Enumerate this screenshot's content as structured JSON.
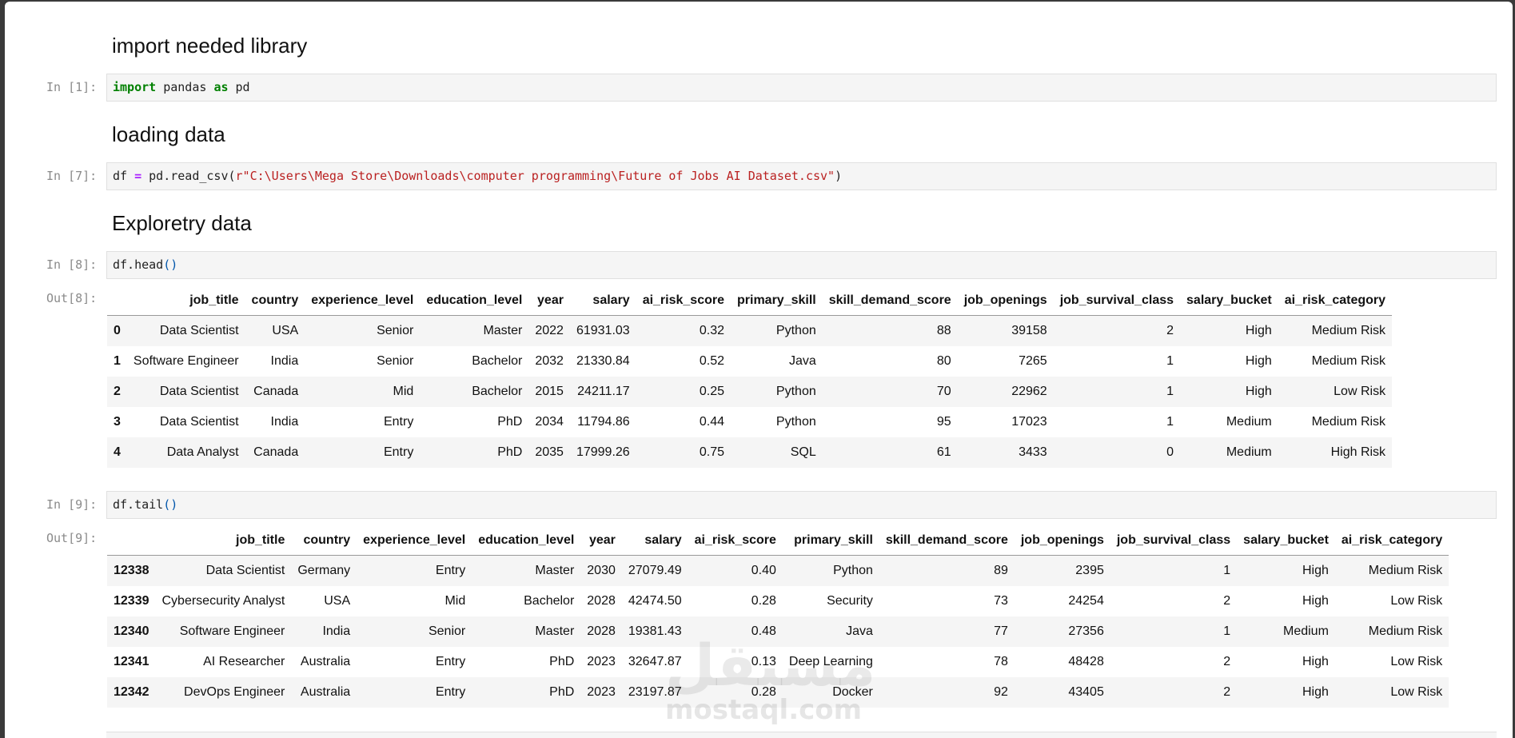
{
  "cells": {
    "md1": "import needed library",
    "in1": {
      "prompt": "In [1]:",
      "kw1": "import",
      "mid": " pandas ",
      "kw2": "as",
      "end": " pd"
    },
    "md2": "loading data",
    "in7": {
      "prompt": "In [7]:",
      "a": "df ",
      "op": "=",
      "b": " pd.read_csv(",
      "str": "r\"C:\\Users\\Mega Store\\Downloads\\computer programming\\Future of Jobs AI Dataset.csv\"",
      "c": ")"
    },
    "md3": "Exploretry data",
    "in8": {
      "prompt": "In [8]:",
      "code": "df.head",
      "paren": "()"
    },
    "out8": "Out[8]:",
    "in9": {
      "prompt": "In [9]:",
      "code": "df.tail",
      "paren": "()"
    },
    "out9": "Out[9]:"
  },
  "columns": [
    "job_title",
    "country",
    "experience_level",
    "education_level",
    "year",
    "salary",
    "ai_risk_score",
    "primary_skill",
    "skill_demand_score",
    "job_openings",
    "job_survival_class",
    "salary_bucket",
    "ai_risk_category"
  ],
  "head_rows": [
    [
      "0",
      "Data Scientist",
      "USA",
      "Senior",
      "Master",
      "2022",
      "61931.03",
      "0.32",
      "Python",
      "88",
      "39158",
      "2",
      "High",
      "Medium Risk"
    ],
    [
      "1",
      "Software Engineer",
      "India",
      "Senior",
      "Bachelor",
      "2032",
      "21330.84",
      "0.52",
      "Java",
      "80",
      "7265",
      "1",
      "High",
      "Medium Risk"
    ],
    [
      "2",
      "Data Scientist",
      "Canada",
      "Mid",
      "Bachelor",
      "2015",
      "24211.17",
      "0.25",
      "Python",
      "70",
      "22962",
      "1",
      "High",
      "Low Risk"
    ],
    [
      "3",
      "Data Scientist",
      "India",
      "Entry",
      "PhD",
      "2034",
      "11794.86",
      "0.44",
      "Python",
      "95",
      "17023",
      "1",
      "Medium",
      "Medium Risk"
    ],
    [
      "4",
      "Data Analyst",
      "Canada",
      "Entry",
      "PhD",
      "2035",
      "17999.26",
      "0.75",
      "SQL",
      "61",
      "3433",
      "0",
      "Medium",
      "High Risk"
    ]
  ],
  "tail_rows": [
    [
      "12338",
      "Data Scientist",
      "Germany",
      "Entry",
      "Master",
      "2030",
      "27079.49",
      "0.40",
      "Python",
      "89",
      "2395",
      "1",
      "High",
      "Medium Risk"
    ],
    [
      "12339",
      "Cybersecurity Analyst",
      "USA",
      "Mid",
      "Bachelor",
      "2028",
      "42474.50",
      "0.28",
      "Security",
      "73",
      "24254",
      "2",
      "High",
      "Low Risk"
    ],
    [
      "12340",
      "Software Engineer",
      "India",
      "Senior",
      "Master",
      "2028",
      "19381.43",
      "0.48",
      "Java",
      "77",
      "27356",
      "1",
      "Medium",
      "Medium Risk"
    ],
    [
      "12341",
      "AI Researcher",
      "Australia",
      "Entry",
      "PhD",
      "2023",
      "32647.87",
      "0.13",
      "Deep Learning",
      "78",
      "48428",
      "2",
      "High",
      "Low Risk"
    ],
    [
      "12342",
      "DevOps Engineer",
      "Australia",
      "Entry",
      "PhD",
      "2023",
      "23197.87",
      "0.28",
      "Docker",
      "92",
      "43405",
      "2",
      "High",
      "Low Risk"
    ]
  ],
  "watermark": {
    "arabic": "مستقل",
    "latin": "mostaql.com"
  }
}
